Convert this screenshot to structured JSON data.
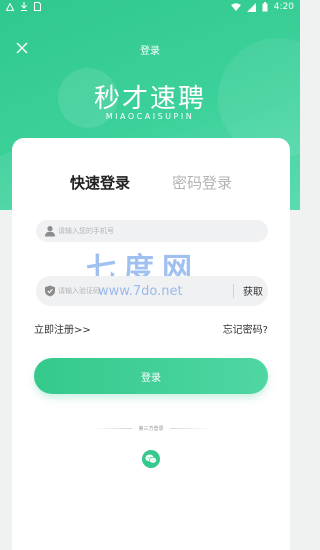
{
  "status_bar": {
    "time": "4:20",
    "left_icons": [
      "warning-icon",
      "download-icon",
      "sim-icon"
    ],
    "right_icons": [
      "wifi-icon",
      "signal-icon",
      "battery-icon"
    ]
  },
  "nav": {
    "title": "登录",
    "close_icon": "close-icon"
  },
  "brand": {
    "name": "秒才速聘",
    "subtitle": "MIAOCAISUPIN"
  },
  "tabs": [
    {
      "label": "快速登录",
      "active": true
    },
    {
      "label": "密码登录",
      "active": false
    }
  ],
  "form": {
    "phone": {
      "placeholder": "请输入您的手机号",
      "value": "",
      "icon": "user-icon"
    },
    "code": {
      "placeholder": "请输入验证码",
      "value": "",
      "icon": "shield-icon",
      "button_label": "获取"
    }
  },
  "links": {
    "register": "立即注册>>",
    "forgot": "忘记密码?"
  },
  "login_button": "登录",
  "third_party": {
    "label": "第三方登录",
    "wechat_icon": "wechat-icon"
  },
  "watermark": {
    "brand": "七度网",
    "url": "www.7do.net"
  },
  "colors": {
    "accent": "#35c98c",
    "header_gradient_start": "#30c88e",
    "header_gradient_end": "#5bdcaf",
    "watermark": "#508ce6"
  }
}
